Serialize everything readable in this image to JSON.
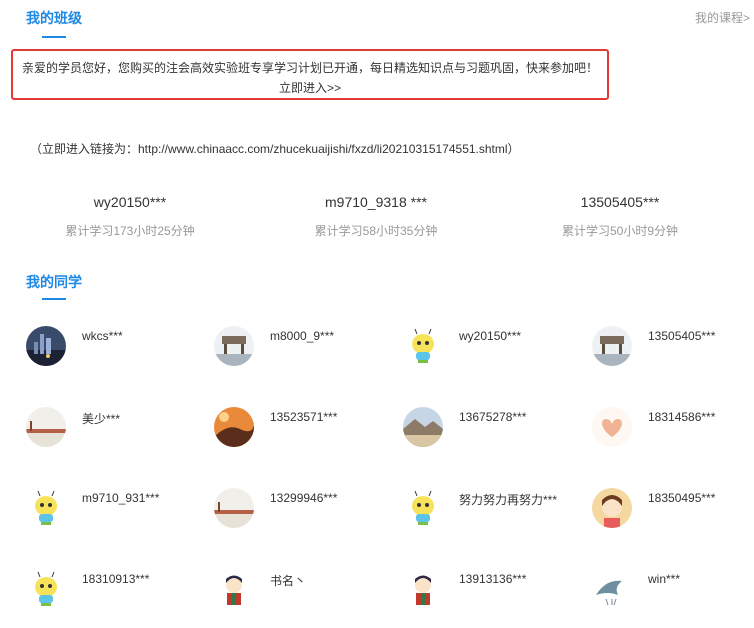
{
  "header": {
    "title": "我的班级",
    "course_link": "我的课程>"
  },
  "notice": {
    "message": "亲爱的学员您好，您购买的注会高效实验班专享学习计划已开通，每日精选知识点与习题巩固，快来参加吧！",
    "enter_label": "立即进入>>"
  },
  "link_note": "（立即进入链接为：http://www.chinaacc.com/zhucekuaijishi/fxzd/li20210315174551.shtml）",
  "top_learners": [
    {
      "name": "wy20150***",
      "time": "累计学习173小时25分钟"
    },
    {
      "name": "m9710_9318 ***",
      "time": "累计学习58小时35分钟"
    },
    {
      "name": "13505405***",
      "time": "累计学习50小时9分钟"
    }
  ],
  "classmates": {
    "title": "我的同学",
    "items": [
      {
        "name": "wkcs***",
        "avatar": "night-city-avatar"
      },
      {
        "name": "m8000_9***",
        "avatar": "bridge-scene-avatar"
      },
      {
        "name": "wy20150***",
        "avatar": "cartoon-bee-avatar"
      },
      {
        "name": "13505405***",
        "avatar": "bridge-scene-avatar"
      },
      {
        "name": "美少***",
        "avatar": "lake-scene-avatar"
      },
      {
        "name": "13523571***",
        "avatar": "orange-sunset-avatar"
      },
      {
        "name": "13675278***",
        "avatar": "landscape-avatar"
      },
      {
        "name": "18314586***",
        "avatar": "heart-hands-avatar"
      },
      {
        "name": "m9710_931***",
        "avatar": "cartoon-bee-avatar"
      },
      {
        "name": "13299946***",
        "avatar": "lake-scene-avatar"
      },
      {
        "name": "努力努力再努力***",
        "avatar": "cartoon-bee-avatar"
      },
      {
        "name": "18350495***",
        "avatar": "cartoon-girl-avatar"
      },
      {
        "name": "18310913***",
        "avatar": "cartoon-bee-avatar"
      },
      {
        "name": "书名丶",
        "avatar": "cartoon-boy-avatar"
      },
      {
        "name": "13913136***",
        "avatar": "cartoon-boy-avatar"
      },
      {
        "name": "win***",
        "avatar": "wave-sketch-avatar"
      }
    ]
  },
  "colors": {
    "accent": "#1e88e5",
    "alert_border": "#e53935",
    "muted": "#999999"
  }
}
